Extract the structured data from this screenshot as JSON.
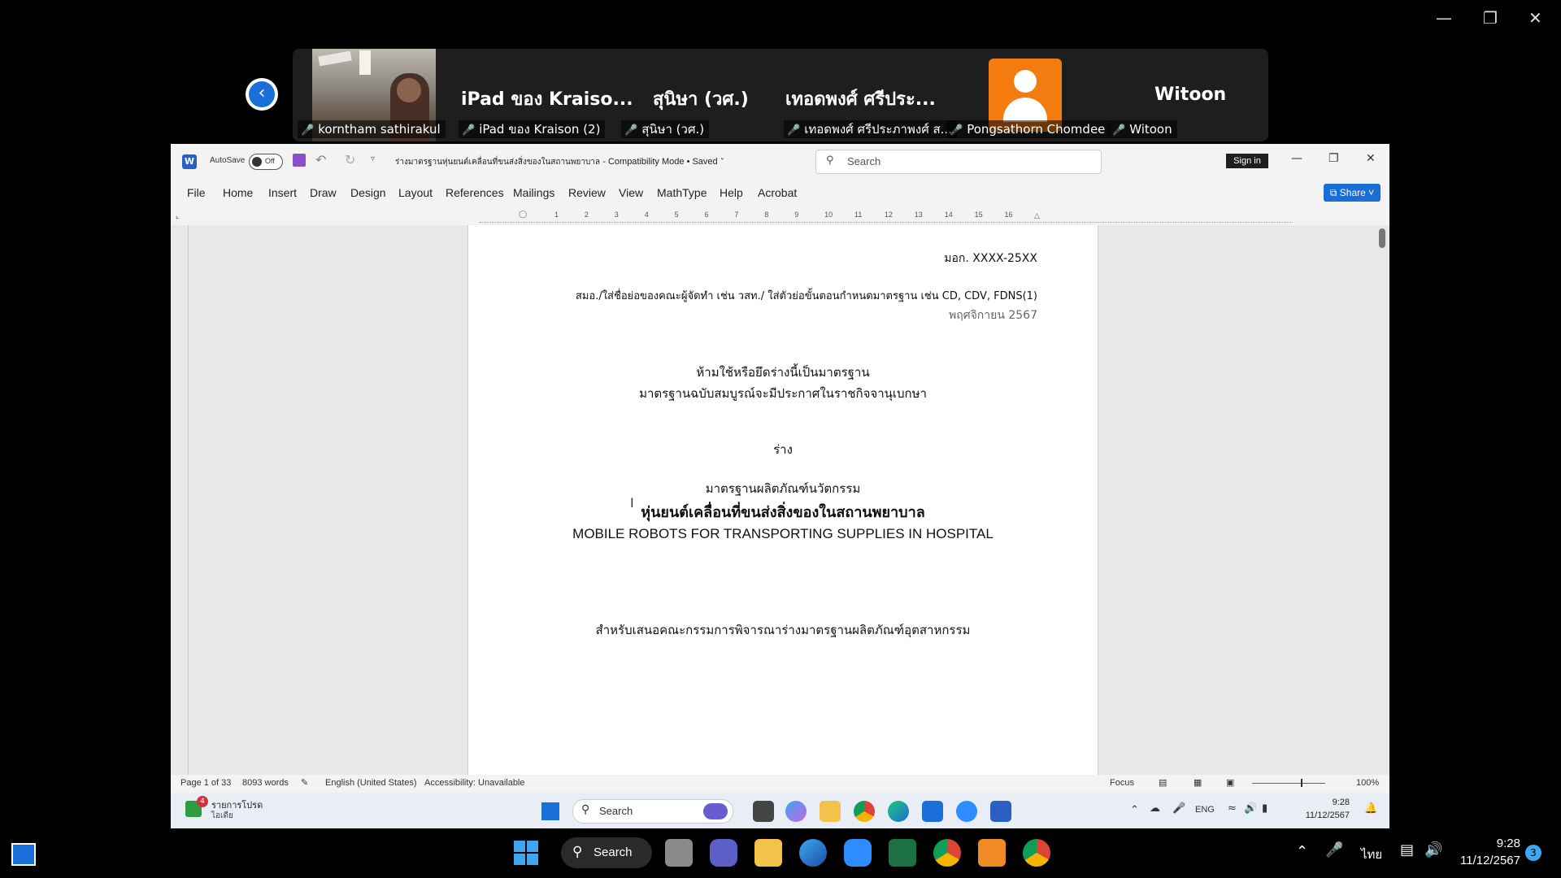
{
  "zoom": {
    "participants": [
      {
        "tile_name": "",
        "label": "korntham sathirakul"
      },
      {
        "tile_name": "iPad ของ Kraiso...",
        "label": "iPad ของ Kraison (2)"
      },
      {
        "tile_name": "สุนิษา (วศ.)",
        "label": "สุนิษา (วศ.)"
      },
      {
        "tile_name": "เทอดพงศ์ ศรีประ...",
        "label": "เทอดพงศ์ ศรีประภาพงศ์ ส..."
      },
      {
        "tile_name": "",
        "label": "Pongsathorn Chomdee"
      },
      {
        "tile_name": "Witoon",
        "label": "Witoon"
      }
    ]
  },
  "word": {
    "autosave_label": "AutoSave",
    "autosave_state": "Off",
    "doc_title": "ร่างมาตรฐานหุ่นยนต์เคลื่อนที่ขนส่งสิ่งของในสถานพยาบาล",
    "mode": "- Compatibility Mode • Saved",
    "search_placeholder": "Search",
    "sign_in": "Sign in",
    "share": "Share",
    "tabs": [
      "File",
      "Home",
      "Insert",
      "Draw",
      "Design",
      "Layout",
      "References",
      "Mailings",
      "Review",
      "View",
      "MathType",
      "Help",
      "Acrobat"
    ],
    "ruler_numbers": [
      "1",
      "2",
      "3",
      "4",
      "5",
      "6",
      "7",
      "8",
      "9",
      "10",
      "11",
      "12",
      "13",
      "14",
      "15",
      "16"
    ],
    "doc": {
      "code": "มอก. XXXX-25XX",
      "committee": "สมอ./ใส่ชื่อย่อของคณะผู้จัดทำ เช่น วสท./ ใส่ตัวย่อขั้นตอนกำหนดมาตรฐาน เช่น CD, CDV, FDNS(1)",
      "date": "พฤศจิกายน 2567",
      "warning1": "ห้ามใช้หรือยึดร่างนี้เป็นมาตรฐาน",
      "warning2": "มาตรฐานฉบับสมบูรณ์จะมีประกาศในราชกิจจานุเบกษา",
      "draft": "ร่าง",
      "category": "มาตรฐานผลิตภัณฑ์นวัตกรรม",
      "title_th": "หุ่นยนต์เคลื่อนที่ขนส่งสิ่งของในสถานพยาบาล",
      "title_en": "MOBILE ROBOTS FOR TRANSPORTING SUPPLIES IN HOSPITAL",
      "purpose": "สำหรับเสนอคณะกรรมการพิจารณาร่างมาตรฐานผลิตภัณฑ์อุตสาหกรรม"
    },
    "status": {
      "page": "Page 1 of 33",
      "words": "8093 words",
      "language": "English (United States)",
      "accessibility": "Accessibility: Unavailable",
      "focus": "Focus",
      "zoom": "100%"
    }
  },
  "inner_taskbar": {
    "notif_title": "รายการโปรด",
    "notif_sub": "ไอเดีย",
    "notif_badge": "4",
    "search": "Search",
    "lang": "ENG",
    "time": "9:28",
    "date": "11/12/2567"
  },
  "taskbar": {
    "search": "Search",
    "lang": "ไทย",
    "time": "9:28",
    "date": "11/12/2567",
    "notif_count": "3"
  }
}
